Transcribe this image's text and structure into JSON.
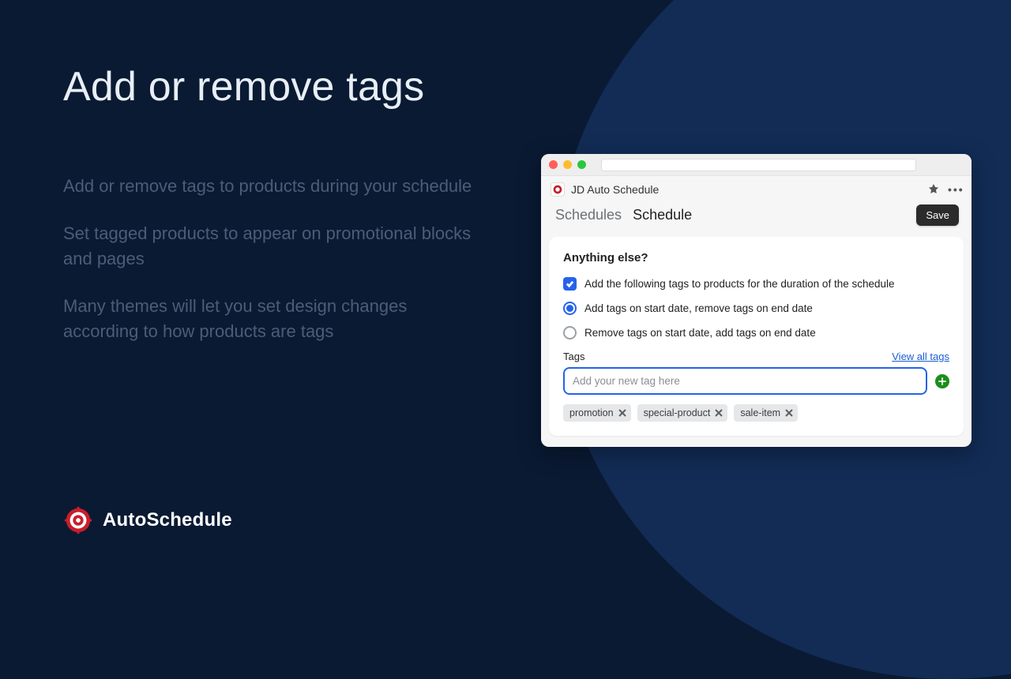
{
  "slide": {
    "headline": "Add or remove tags",
    "paragraphs": [
      "Add or remove tags to products during your schedule",
      "Set tagged products to appear on promotional blocks and pages",
      "Many themes will let you set design changes according to how products are tags"
    ]
  },
  "logo": {
    "text": "AutoSchedule"
  },
  "window": {
    "app_title": "JD Auto Schedule",
    "breadcrumb": {
      "parent": "Schedules",
      "current": "Schedule"
    },
    "save_label": "Save",
    "card": {
      "title": "Anything else?",
      "checkbox_label": "Add the following tags to products for the duration of the schedule",
      "radio_options": [
        {
          "label": "Add tags on start date, remove tags on end date",
          "selected": true
        },
        {
          "label": "Remove tags on start date, add tags on end date",
          "selected": false
        }
      ],
      "tags_label": "Tags",
      "view_all_label": "View all tags",
      "tag_input_placeholder": "Add your new tag here",
      "tags": [
        "promotion",
        "special-product",
        "sale-item"
      ]
    }
  }
}
